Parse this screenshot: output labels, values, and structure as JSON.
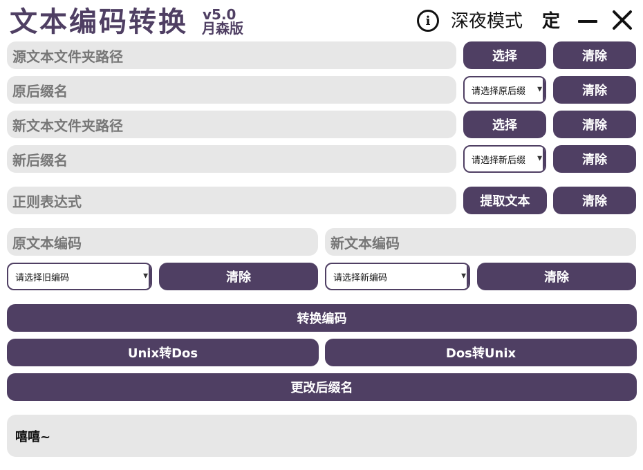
{
  "header": {
    "title": "文本编码转换",
    "version": "v5.0",
    "edition": "月森版",
    "dark_mode_label": "深夜模式",
    "pin_label": "定"
  },
  "rows": {
    "source_folder": {
      "label": "源文本文件夹路径",
      "select_label": "选择",
      "clear_label": "清除"
    },
    "old_suffix": {
      "label": "原后缀名",
      "select_placeholder": "请选择原后缀",
      "clear_label": "清除"
    },
    "new_folder": {
      "label": "新文本文件夹路径",
      "select_label": "选择",
      "clear_label": "清除"
    },
    "new_suffix": {
      "label": "新后缀名",
      "select_placeholder": "请选择新后缀",
      "clear_label": "清除"
    },
    "regex": {
      "label": "正则表达式",
      "extract_label": "提取文本",
      "clear_label": "清除"
    }
  },
  "encoding": {
    "old": {
      "label": "原文本编码",
      "select_placeholder": "请选择旧编码",
      "clear_label": "清除"
    },
    "new": {
      "label": "新文本编码",
      "select_placeholder": "请选择新编码",
      "clear_label": "清除"
    }
  },
  "actions": {
    "convert_label": "转换编码",
    "unix_to_dos_label": "Unix转Dos",
    "dos_to_unix_label": "Dos转Unix",
    "rename_suffix_label": "更改后缀名"
  },
  "output": {
    "text": "嘻嘻~"
  },
  "colors": {
    "accent": "#4f3f63",
    "field_bg": "#e7e7e7",
    "field_text": "#777777"
  }
}
